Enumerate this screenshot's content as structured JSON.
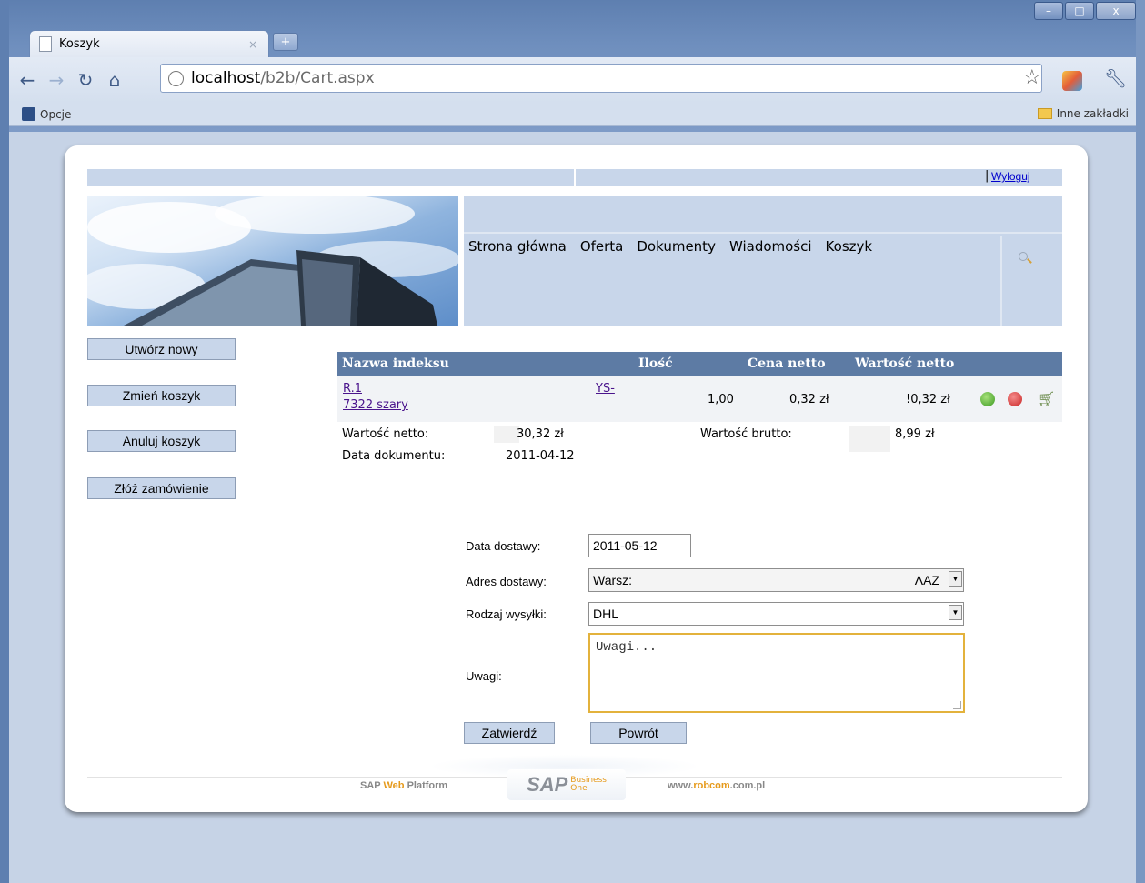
{
  "browser": {
    "tab_title": "Koszyk",
    "tab_close": "×",
    "new_tab": "+",
    "url_host": "localhost",
    "url_path": "/b2b/Cart.aspx",
    "bookmark_left": "Opcje",
    "bookmark_right": "Inne zakładki",
    "window_controls": {
      "minimize": "–",
      "maximize": "□",
      "close": "x"
    }
  },
  "header": {
    "logout_sep": "|",
    "logout": "Wyloguj"
  },
  "nav": {
    "items": [
      "Strona główna",
      "Oferta",
      "Dokumenty",
      "Wiadomości",
      "Koszyk"
    ]
  },
  "sidebar": {
    "buttons": [
      "Utwórz nowy",
      "Zmień koszyk",
      "Anuluj koszyk",
      "Złóż zamówienie"
    ]
  },
  "cart": {
    "headers": {
      "name": "Nazwa indeksu",
      "qty": "Ilość",
      "price": "Cena netto",
      "value": "Wartość netto"
    },
    "row": {
      "index_line1": "R.1",
      "index_line2": "7322 szary",
      "index_code": "YS-",
      "qty": "1,00",
      "price": "0,32 zł",
      "value": "!0,32 zł"
    }
  },
  "summary": {
    "net_label": "Wartość netto:",
    "net_value": "30,32 zł",
    "gross_label": "Wartość brutto:",
    "gross_value": "8,99 zł",
    "date_label": "Data dokumentu:",
    "date_value": "2011-04-12"
  },
  "form": {
    "delivery_date_label": "Data dostawy:",
    "delivery_date_value": "2011-05-12",
    "address_label": "Adres dostawy:",
    "address_value_left": "Warsz:",
    "address_value_right": "ΛAZ",
    "shipping_label": "Rodzaj wysyłki:",
    "shipping_value": "DHL",
    "notes_label": "Uwagi:",
    "notes_value": "Uwagi...",
    "submit": "Zatwierdź",
    "back": "Powrót"
  },
  "footer": {
    "left_prefix": "SAP ",
    "left_accent": "Web",
    "left_suffix": " Platform",
    "logo_text": "SAP",
    "logo_sub1": "Business",
    "logo_sub2": "One",
    "right_prefix": "www.",
    "right_accent": "robcom",
    "right_suffix": ".com.pl"
  }
}
